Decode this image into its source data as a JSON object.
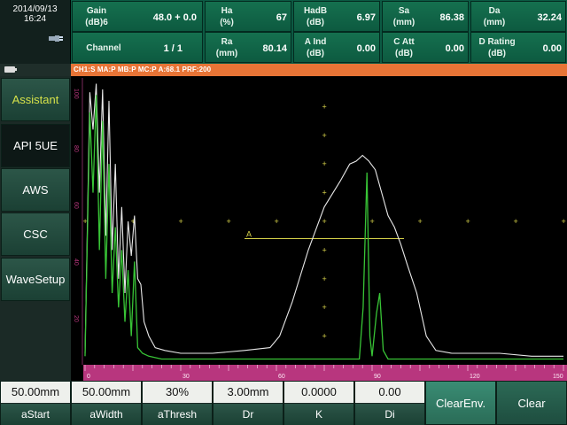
{
  "status": {
    "date": "2014/09/13",
    "time": "16:24"
  },
  "header": {
    "gain": {
      "label": "Gain\n(dB)6",
      "value": "48.0 + 0.0"
    },
    "channel": {
      "label": "Channel",
      "value": "1 / 1"
    },
    "ha": {
      "label": "Ha\n(%)",
      "value": "67"
    },
    "ra": {
      "label": "Ra\n(mm)",
      "value": "80.14"
    },
    "hadb": {
      "label": "HadB\n(dB)",
      "value": "6.97"
    },
    "aind": {
      "label": "A Ind\n(dB)",
      "value": "0.00"
    },
    "sa": {
      "label": "Sa\n(mm)",
      "value": "86.38"
    },
    "catt": {
      "label": "C Att\n(dB)",
      "value": "0.00"
    },
    "da": {
      "label": "Da\n(mm)",
      "value": "32.24"
    },
    "drating": {
      "label": "D Rating\n(dB)",
      "value": "0.00"
    }
  },
  "statusbar": {
    "text": "CH1:S MA:P MB:P MC:P A:68.1 PRF:200"
  },
  "sidemenu": {
    "items": [
      {
        "label": "Assistant"
      },
      {
        "label": "API 5UE"
      },
      {
        "label": "AWS"
      },
      {
        "label": "CSC"
      },
      {
        "label": "WaveSetup"
      }
    ]
  },
  "ascan": {
    "y_ticks": [
      "100",
      "80",
      "60",
      "40",
      "20"
    ],
    "x_ticks": [
      "0",
      "30",
      "60",
      "90",
      "120",
      "150"
    ],
    "gate_label": "A",
    "colors": {
      "envelope": "#e8e8e8",
      "echo": "#38c436",
      "gate": "#d8d34a",
      "grid": "#d8d34a",
      "ruler": "#b8367e"
    }
  },
  "chart_data": {
    "type": "line",
    "title": "",
    "xlabel": "",
    "ylabel": "",
    "xlim": [
      0,
      150
    ],
    "ylim": [
      0,
      100
    ],
    "x_ticks": [
      0,
      30,
      60,
      90,
      120,
      150
    ],
    "y_ticks": [
      20,
      40,
      60,
      80,
      100
    ],
    "grid": true,
    "series": [
      {
        "x": [
          0,
          1.5,
          2.5,
          3.5,
          4.5,
          5.5,
          6.5,
          7.5,
          8.5,
          9.5,
          10.5,
          11.5,
          12.5,
          13.5,
          14.5,
          15.5,
          16.5,
          17.5,
          18.5,
          20,
          22,
          25,
          30,
          40,
          50,
          58,
          61,
          65,
          70,
          75,
          80,
          83,
          85,
          87,
          89,
          91,
          93,
          95,
          97,
          99,
          101,
          102.5,
          104,
          107,
          110,
          115,
          120,
          125,
          130,
          140,
          150
        ],
        "y": [
          4,
          95,
          82,
          98,
          60,
          96,
          45,
          92,
          40,
          70,
          30,
          55,
          25,
          50,
          38,
          52,
          30,
          28,
          15,
          10,
          6,
          5,
          4,
          4,
          5,
          6,
          10,
          22,
          40,
          55,
          64,
          70,
          71,
          73,
          71,
          68,
          60,
          52,
          48,
          42,
          35,
          30,
          25,
          10,
          5,
          4,
          4,
          4,
          4,
          3,
          3
        ]
      },
      {
        "x": [
          0,
          1.5,
          2.5,
          3.5,
          4.5,
          5.5,
          6.5,
          7.5,
          8.5,
          9.5,
          10.5,
          11.5,
          12.5,
          13.5,
          14.5,
          15.5,
          16.5,
          18,
          20,
          24,
          30,
          40,
          50,
          60,
          70,
          80,
          86,
          87.2,
          88.4,
          89.3,
          90,
          91.4,
          92.4,
          93.5,
          95,
          100,
          110,
          120,
          130,
          140,
          150
        ],
        "y": [
          3,
          88,
          60,
          94,
          40,
          85,
          30,
          70,
          25,
          48,
          20,
          40,
          15,
          33,
          10,
          36,
          6,
          4,
          3,
          2,
          2,
          2,
          2,
          2,
          2,
          2,
          2,
          20,
          67,
          10,
          3,
          18,
          25,
          5,
          2,
          2,
          2,
          2,
          2,
          2,
          2
        ]
      }
    ],
    "gate": {
      "start": 50,
      "end": 100,
      "level": 44
    }
  },
  "bottom": {
    "params": [
      {
        "value": "50.00mm",
        "label": "aStart"
      },
      {
        "value": "50.00mm",
        "label": "aWidth"
      },
      {
        "value": "30%",
        "label": "aThresh"
      },
      {
        "value": "3.00mm",
        "label": "Dr"
      },
      {
        "value": "0.0000",
        "label": "K"
      },
      {
        "value": "0.00",
        "label": "Di"
      }
    ],
    "buttons": [
      {
        "label": "ClearEnv."
      },
      {
        "label": "Clear"
      }
    ]
  }
}
